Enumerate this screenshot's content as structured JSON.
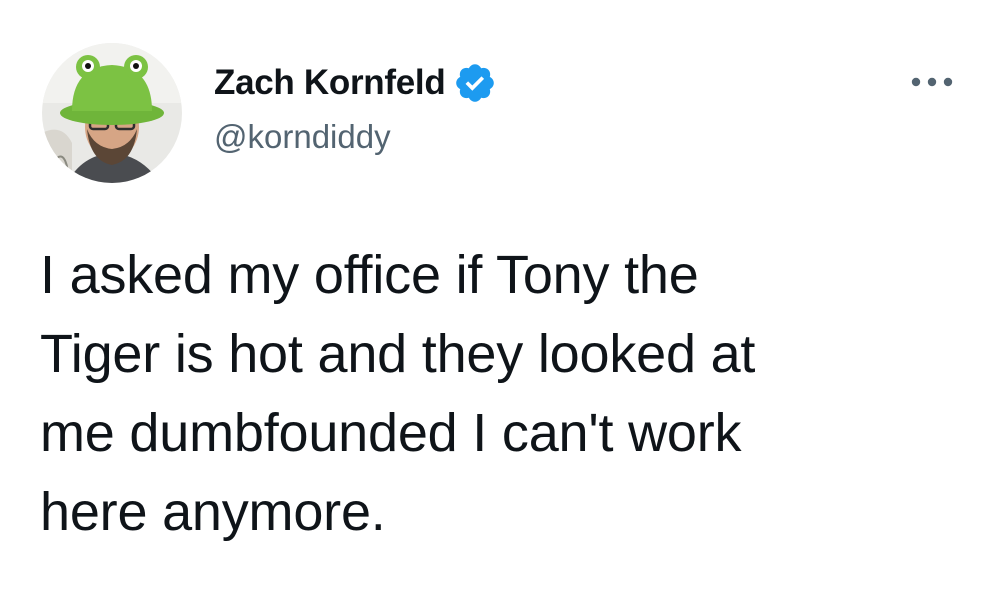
{
  "author": {
    "display_name": "Zach Kornfeld",
    "handle": "@korndiddy",
    "verified": true,
    "verified_icon": "verified-badge-icon",
    "avatar_icon": "profile-avatar"
  },
  "tweet": {
    "lines": [
      "I asked my office if Tony the",
      "Tiger is hot and they looked at",
      "me dumbfounded I can't work",
      "here anymore."
    ]
  },
  "menu": {
    "icon": "more-options-icon"
  },
  "colors": {
    "text": "#0f1419",
    "secondary": "#536471",
    "verified_blue": "#1d9bf0",
    "hat_green": "#7cc243"
  }
}
